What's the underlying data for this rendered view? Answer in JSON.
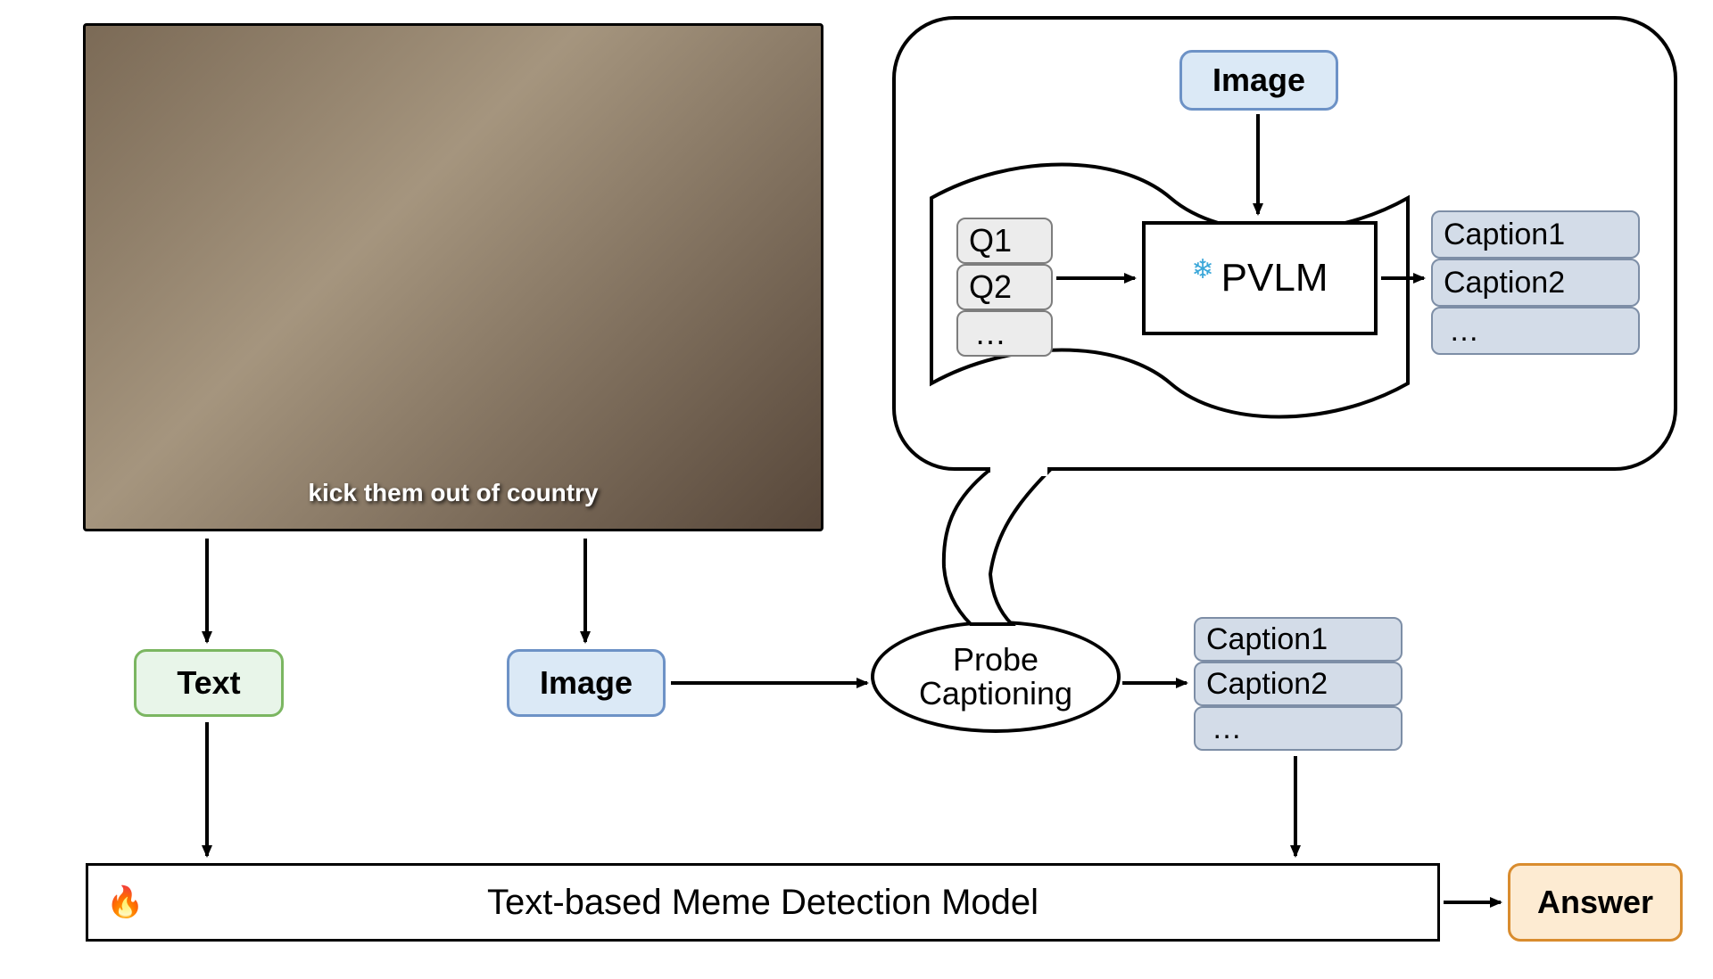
{
  "meme": {
    "caption_text": "kick them out of country"
  },
  "nodes": {
    "text_label": "Text",
    "image_label": "Image",
    "image_bubble_label": "Image",
    "pvlm_label": "PVLM",
    "probe_line1": "Probe",
    "probe_line2": "Captioning",
    "detection_label": "Text-based Meme Detection Model",
    "answer_label": "Answer"
  },
  "queries": {
    "q1": "Q1",
    "q2": "Q2",
    "ellipsis": "…"
  },
  "captions_bubble": {
    "c1": "Caption1",
    "c2": "Caption2",
    "ellipsis": "…"
  },
  "captions_bottom": {
    "c1": "Caption1",
    "c2": "Caption2",
    "ellipsis": "…"
  },
  "icons": {
    "fire": "🔥",
    "snowflake": "❄"
  },
  "diagram": {
    "description": "Pipeline for text-based meme detection. A meme image yields its overlaid Text and the Image. The Image is fed to Probe Captioning: a frozen pretrained vision-language model (PVLM) is queried with Q1, Q2, … together with the Image to produce Caption1, Caption2, …. The Text plus the generated captions go into a trainable Text-based Meme Detection Model, which outputs the Answer.",
    "frozen": "PVLM (frozen ❄)",
    "trainable": "Text-based Meme Detection Model (trainable 🔥)"
  }
}
